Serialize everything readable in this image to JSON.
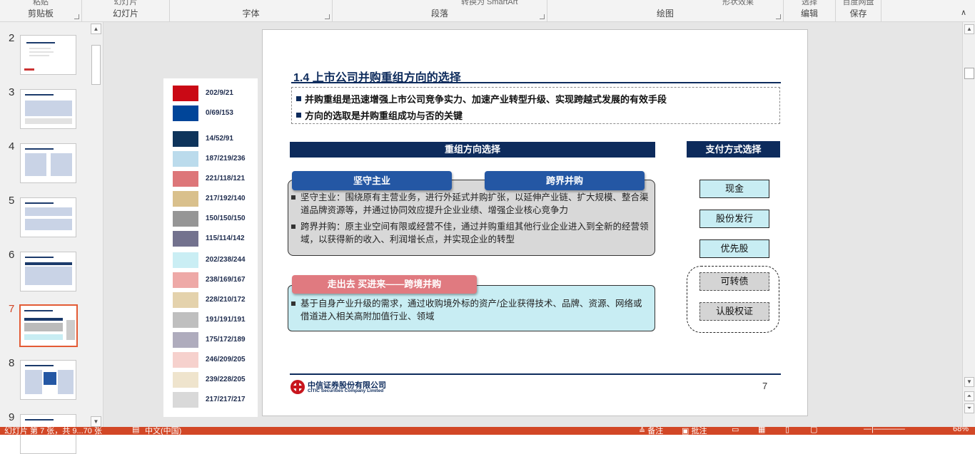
{
  "ribbon": {
    "groups": [
      {
        "caption": "剪贴板",
        "clip": "粘贴"
      },
      {
        "caption": "幻灯片",
        "clip": "幻灯片"
      },
      {
        "caption": "字体",
        "clip": ""
      },
      {
        "caption": "段落",
        "clip": "转换为 SmartArt"
      },
      {
        "caption": "绘图",
        "clip": "形状效果"
      },
      {
        "caption": "编辑",
        "clip": "选择"
      },
      {
        "caption": "保存",
        "clip": "百度网盘"
      }
    ],
    "collapse_icon": "chevron-up-icon"
  },
  "thumbnails": [
    {
      "num": "2"
    },
    {
      "num": "3"
    },
    {
      "num": "4"
    },
    {
      "num": "5"
    },
    {
      "num": "6"
    },
    {
      "num": "7"
    },
    {
      "num": "8"
    },
    {
      "num": "9"
    }
  ],
  "palette": [
    {
      "label": "202/9/21",
      "color": "#ca0915"
    },
    {
      "label": "0/69/153",
      "color": "#004599"
    },
    {
      "label": "14/52/91",
      "color": "#0e345b"
    },
    {
      "label": "187/219/236",
      "color": "#bbdbec"
    },
    {
      "label": "221/118/121",
      "color": "#dd7679"
    },
    {
      "label": "217/192/140",
      "color": "#d9c08c"
    },
    {
      "label": "150/150/150",
      "color": "#969696"
    },
    {
      "label": "115/114/142",
      "color": "#73728e"
    },
    {
      "label": "202/238/244",
      "color": "#caeef4"
    },
    {
      "label": "238/169/167",
      "color": "#eea9a7"
    },
    {
      "label": "228/210/172",
      "color": "#e4d2ac"
    },
    {
      "label": "191/191/191",
      "color": "#bfbfbf"
    },
    {
      "label": "175/172/189",
      "color": "#afacbd"
    },
    {
      "label": "246/209/205",
      "color": "#f6d1cd"
    },
    {
      "label": "239/228/205",
      "color": "#efe4cd"
    },
    {
      "label": "217/217/217",
      "color": "#d9d9d9"
    }
  ],
  "slide": {
    "title": "1.4 上市公司并购重组方向的选择",
    "key_points": [
      "并购重组是迅速增强上市公司竞争实力、加速产业转型升级、实现跨越式发展的有效手段",
      "方向的选取是并购重组成功与否的关键"
    ],
    "section_left": "重组方向选择",
    "section_right": "支付方式选择",
    "pill_1": "坚守主业",
    "pill_2": "跨界并购",
    "bullet_1": "坚守主业：围绕原有主营业务，进行外延式并购扩张，以延伸产业链、扩大规模、整合渠道品牌资源等，并通过协同效应提升企业业绩、增强企业核心竞争力",
    "bullet_2": "跨界并购：原主业空间有限或经营不佳，通过并购重组其他行业企业进入到全新的经营领域，以获得新的收入、利润增长点，并实现企业的转型",
    "pill_3": "走出去 买进来——跨境并购",
    "bullet_3": "基于自身产业升级的需求，通过收购境外标的资产/企业获得技术、品牌、资源、网络或借道进入相关高附加值行业、领域",
    "payments": [
      "现金",
      "股份发行",
      "优先股"
    ],
    "payments_dashed": [
      "可转债",
      "认股权证"
    ],
    "logo_cn": "中信证券股份有限公司",
    "logo_en": "CITIC Securities Company Limited",
    "page_number": "7"
  },
  "status": {
    "slide_info": "幻灯片 第 7 张，共 9...70 张",
    "language": "中文(中国)",
    "notes": "备注",
    "comments": "批注",
    "zoom": "68%"
  }
}
